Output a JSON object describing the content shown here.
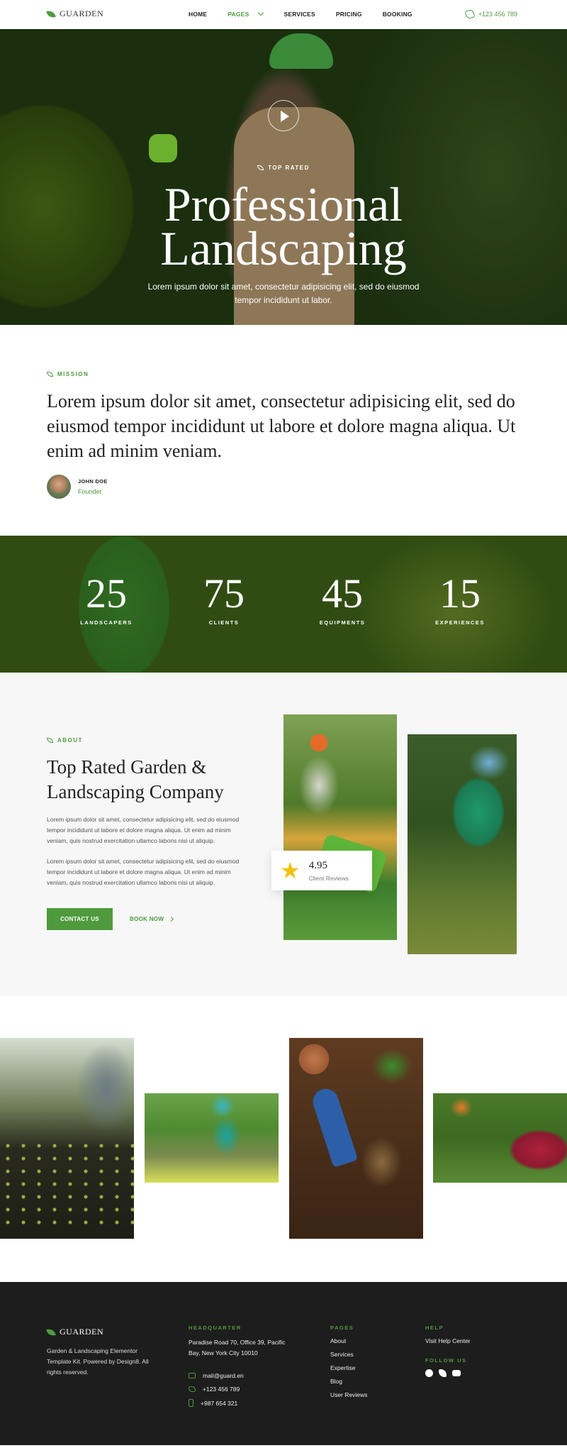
{
  "brand": {
    "name": "GUARDEN",
    "accent": "#4f9a3d"
  },
  "nav": {
    "items": [
      {
        "label": "HOME"
      },
      {
        "label": "PAGES"
      },
      {
        "label": "SERVICES"
      },
      {
        "label": "PRICING"
      },
      {
        "label": "BOOKING"
      }
    ],
    "phone": "+123 456 789"
  },
  "hero": {
    "eyebrow": "TOP RATED",
    "title_line1": "Professional",
    "title_line2": "Landscaping",
    "subtitle": "Lorem ipsum dolor sit amet, consectetur adipisicing elit, sed do eiusmod tempor incididunt ut labor."
  },
  "mission": {
    "eyebrow": "MISSION",
    "quote": "Lorem ipsum dolor sit amet, consectetur adipisicing elit, sed do eiusmod tempor incididunt ut labore et dolore magna aliqua. Ut enim ad minim veniam.",
    "author_name": "JOHN DOE",
    "author_role": "Founder"
  },
  "stats": [
    {
      "value": "25",
      "label": "LANDSCAPERS"
    },
    {
      "value": "75",
      "label": "CLIENTS"
    },
    {
      "value": "45",
      "label": "EQUIPMENTS"
    },
    {
      "value": "15",
      "label": "EXPERIENCES"
    }
  ],
  "about": {
    "eyebrow": "ABOUT",
    "title": "Top Rated Garden & Landscaping Company",
    "paragraph1": "Lorem ipsum dolor sit amet, consectetur adipisicing elit, sed do eiusmod tempor incididunt ut labore et dolore magna aliqua. Ut enim ad minim veniam, quis nostrud exercitation ullamco laboris nisi ut aliquip.",
    "paragraph2": "Lorem ipsum dolor sit amet, consectetur adipisicing elit, sed do eiusmod tempor incididunt ut labore et dolore magna aliqua. Ut enim ad minim veniam, quis nostrud exercitation ullamco laboris nisi ut aliquip.",
    "contact_button": "CONTACT US",
    "book_link": "BOOK NOW",
    "review_score": "4.95",
    "review_label": "Client Reviews"
  },
  "footer": {
    "brand": "GUARDEN",
    "about": "Garden & Landscaping Elementor Template Kit. Powered by Design8. All rights reserved.",
    "headquarter_title": "HEADQUARTER",
    "address": "Paradise Road 70, Office 39, Pacific Bay, New York City 10010",
    "email": "mail@guard.en",
    "phone1": "+123 456 789",
    "phone2": "+987 654 321",
    "pages_title": "PAGES",
    "pages": [
      "About",
      "Services",
      "Expertise",
      "Blog",
      "User Reviews"
    ],
    "help_title": "HELP",
    "help_link": "Visit Help Center",
    "follow_title": "FOLLOW US"
  }
}
